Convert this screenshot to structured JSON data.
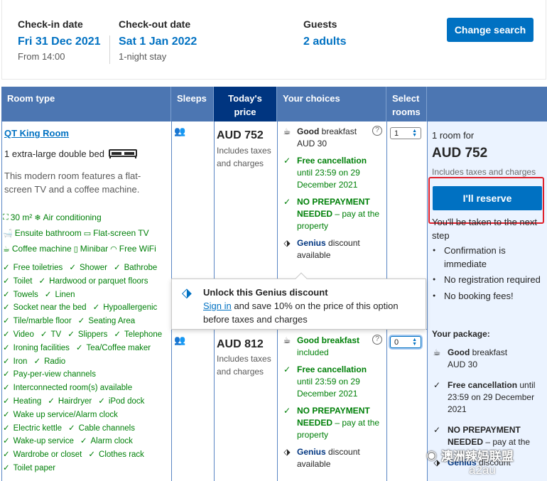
{
  "summary": {
    "checkin_label": "Check-in date",
    "checkin_value": "Fri 31 Dec 2021",
    "checkin_sub": "From 14:00",
    "checkout_label": "Check-out date",
    "checkout_value": "Sat 1 Jan 2022",
    "checkout_sub": "1-night stay",
    "guests_label": "Guests",
    "guests_value": "2 adults",
    "change_button": "Change search"
  },
  "table": {
    "headers": {
      "room_type": "Room type",
      "sleeps": "Sleeps",
      "todays_price": "Today's price",
      "your_choices": "Your choices",
      "select_rooms": "Select rooms"
    }
  },
  "room": {
    "name": "QT King Room",
    "bed": "1 extra-large double bed",
    "description": "This modern room features a flat-screen TV and a coffee machine.",
    "facilities": [
      {
        "icon": "size-icon",
        "label": "30 m²"
      },
      {
        "icon": "snowflake-icon",
        "label": "Air conditioning"
      },
      {
        "icon": "bath-icon",
        "label": "Ensuite bathroom"
      },
      {
        "icon": "tv-icon",
        "label": "Flat-screen TV"
      },
      {
        "icon": "coffee-icon",
        "label": "Coffee machine"
      },
      {
        "icon": "minibar-icon",
        "label": "Minibar"
      },
      {
        "icon": "wifi-icon",
        "label": "Free WiFi"
      }
    ],
    "amenities": [
      "Free toiletries",
      "Shower",
      "Bathrobe",
      "Toilet",
      "Hardwood or parquet floors",
      "Towels",
      "Linen",
      "Socket near the bed",
      "Hypoallergenic",
      "Tile/marble floor",
      "Seating Area",
      "Video",
      "TV",
      "Slippers",
      "Telephone",
      "Ironing facilities",
      "Tea/Coffee maker",
      "Iron",
      "Radio",
      "Pay-per-view channels",
      "Interconnected room(s) available",
      "Heating",
      "Hairdryer",
      "iPod dock",
      "Wake up service/Alarm clock",
      "Electric kettle",
      "Cable channels",
      "Wake-up service",
      "Alarm clock",
      "Wardrobe or closet",
      "Clothes rack",
      "Toilet paper"
    ]
  },
  "options": [
    {
      "price": "AUD 752",
      "price_sub": "Includes taxes and charges",
      "breakfast_bold": "Good",
      "breakfast_rest": " breakfast",
      "breakfast_sub": "AUD 30",
      "cancel_title": "Free cancellation",
      "cancel_sub": "until 23:59 on 29 December 2021",
      "prepay_title": "NO PREPAYMENT NEEDED",
      "prepay_sub": " – pay at the property",
      "genius_word": "Genius",
      "genius_rest": " discount available",
      "selected_rooms": "1"
    },
    {
      "price": "AUD 812",
      "price_sub": "Includes taxes and charges",
      "breakfast_bold": "Good breakfast",
      "breakfast_rest": "",
      "breakfast_sub": "included",
      "cancel_title": "Free cancellation",
      "cancel_sub": "until 23:59 on 29 December 2021",
      "prepay_title": "NO PREPAYMENT NEEDED",
      "prepay_sub": " – pay at the property",
      "genius_word": "Genius",
      "genius_rest": " discount available",
      "selected_rooms": "0"
    }
  ],
  "popup": {
    "title": "Unlock this Genius discount",
    "link": "Sign in",
    "text": " and save 10% on the price of this option before taxes and charges"
  },
  "reserve": {
    "rooms_for": "1 room for",
    "total": "AUD 752",
    "total_sub": "Includes taxes and charges",
    "button": "I'll reserve",
    "note": "You'll be taken to the next step",
    "bullets": [
      "Confirmation is immediate",
      "No registration required",
      "No booking fees!"
    ],
    "package_label": "Your package:",
    "pkg_breakfast_bold": "Good",
    "pkg_breakfast_rest": " breakfast",
    "pkg_breakfast_sub": "AUD 30",
    "pkg_cancel_title": "Free cancellation",
    "pkg_cancel_rest": " until 23:59 on 29 December 2021",
    "pkg_prepay_title": "NO PREPAYMENT NEEDED",
    "pkg_prepay_rest": " – pay at the",
    "pkg_genius_word": "Genius",
    "pkg_genius_rest": " discount"
  },
  "watermark": {
    "line1": "澳洲辣妈联盟",
    "line2": "a2au"
  }
}
